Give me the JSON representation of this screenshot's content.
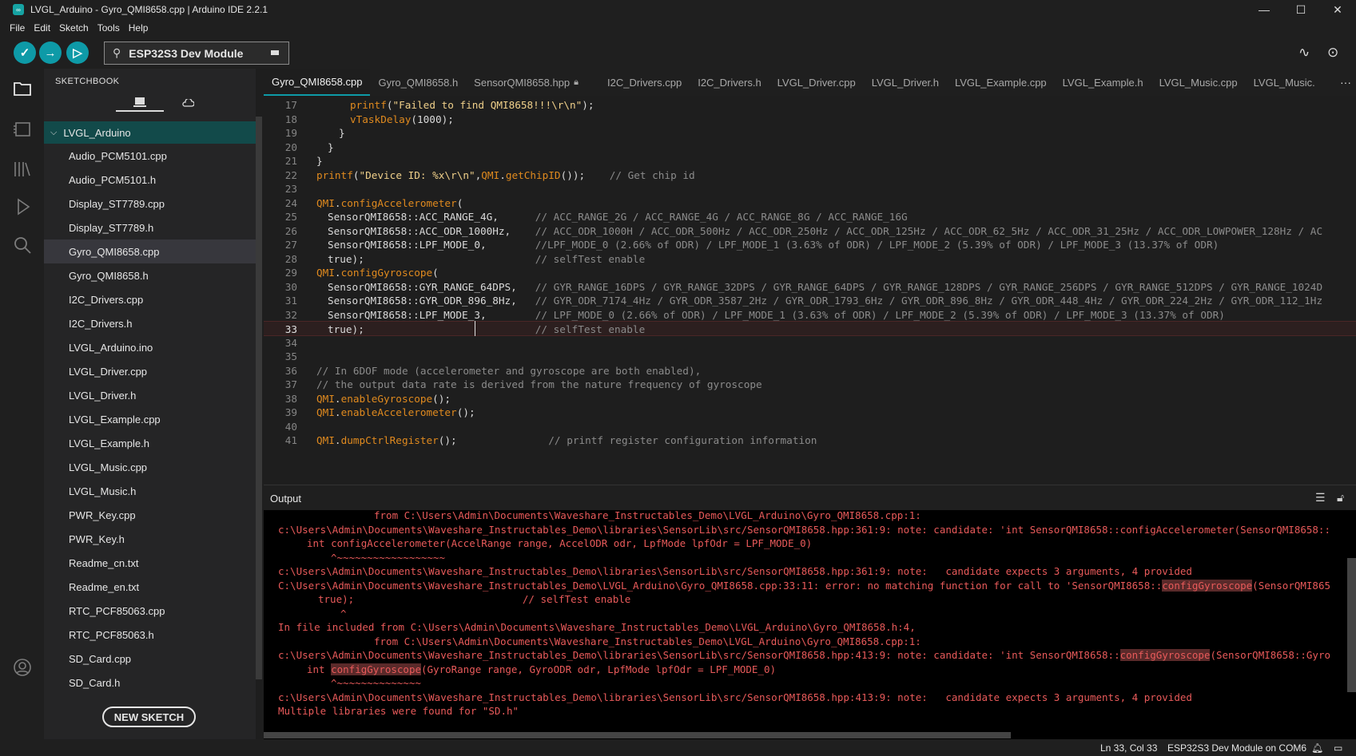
{
  "window": {
    "title": "LVGL_Arduino - Gyro_QMI8658.cpp | Arduino IDE 2.2.1",
    "app_icon": "arduino-logo",
    "minimize": "—",
    "maximize": "☐",
    "close": "✕"
  },
  "menu": [
    "File",
    "Edit",
    "Sketch",
    "Tools",
    "Help"
  ],
  "toolbar": {
    "board": "ESP32S3 Dev Module",
    "verify_icon": "✓",
    "upload_icon": "→",
    "debug_icon": "▷",
    "serial_plotter_icon": "∿",
    "serial_monitor_icon": "⊙",
    "accent": "#0e9aa7"
  },
  "sidebar": {
    "title": "SKETCHBOOK",
    "local_tab_icon": "laptop-icon",
    "cloud_tab_icon": "cloud-icon",
    "folder": "LVGL_Arduino",
    "files": [
      "Audio_PCM5101.cpp",
      "Audio_PCM5101.h",
      "Display_ST7789.cpp",
      "Display_ST7789.h",
      "Gyro_QMI8658.cpp",
      "Gyro_QMI8658.h",
      "I2C_Drivers.cpp",
      "I2C_Drivers.h",
      "LVGL_Arduino.ino",
      "LVGL_Driver.cpp",
      "LVGL_Driver.h",
      "LVGL_Example.cpp",
      "LVGL_Example.h",
      "LVGL_Music.cpp",
      "LVGL_Music.h",
      "PWR_Key.cpp",
      "PWR_Key.h",
      "Readme_cn.txt",
      "Readme_en.txt",
      "RTC_PCF85063.cpp",
      "RTC_PCF85063.h",
      "SD_Card.cpp",
      "SD_Card.h"
    ],
    "selected_file": "Gyro_QMI8658.cpp",
    "new_sketch": "NEW SKETCH"
  },
  "tabs": [
    "Gyro_QMI8658.cpp",
    "Gyro_QMI8658.h",
    "SensorQMI8658.hpp",
    "I2C_Drivers.cpp",
    "I2C_Drivers.h",
    "LVGL_Driver.cpp",
    "LVGL_Driver.h",
    "LVGL_Example.cpp",
    "LVGL_Example.h",
    "LVGL_Music.cpp",
    "LVGL_Music."
  ],
  "code": {
    "current_line": 33,
    "lines": [
      {
        "n": "17",
        "text": "printf(\"Failed to find QMI8658!!!\\r\\n\");"
      },
      {
        "n": "18",
        "text": "vTaskDelay(1000);"
      },
      {
        "n": "19",
        "text": "}"
      },
      {
        "n": "20",
        "text": "}"
      },
      {
        "n": "21",
        "text": "}"
      },
      {
        "n": "22",
        "text": "printf(\"Device ID: %x\\r\\n\",QMI.getChipID());    // Get chip id"
      },
      {
        "n": "23",
        "text": ""
      },
      {
        "n": "24",
        "text": "QMI.configAccelerometer("
      },
      {
        "n": "25",
        "text": "SensorQMI8658::ACC_RANGE_4G,      // ACC_RANGE_2G / ACC_RANGE_4G / ACC_RANGE_8G / ACC_RANGE_16G"
      },
      {
        "n": "26",
        "text": "SensorQMI8658::ACC_ODR_1000Hz,    // ACC_ODR_1000H / ACC_ODR_500Hz / ACC_ODR_250Hz / ACC_ODR_125Hz / ACC_ODR_62_5Hz / ACC_ODR_31_25Hz / ACC_ODR_LOWPOWER_128Hz / AC"
      },
      {
        "n": "27",
        "text": "SensorQMI8658::LPF_MODE_0,        //LPF_MODE_0 (2.66% of ODR) / LPF_MODE_1 (3.63% of ODR) / LPF_MODE_2 (5.39% of ODR) / LPF_MODE_3 (13.37% of ODR)"
      },
      {
        "n": "28",
        "text": "true);                            // selfTest enable"
      },
      {
        "n": "29",
        "text": "QMI.configGyroscope("
      },
      {
        "n": "30",
        "text": "SensorQMI8658::GYR_RANGE_64DPS,   // GYR_RANGE_16DPS / GYR_RANGE_32DPS / GYR_RANGE_64DPS / GYR_RANGE_128DPS / GYR_RANGE_256DPS / GYR_RANGE_512DPS / GYR_RANGE_1024D"
      },
      {
        "n": "31",
        "text": "SensorQMI8658::GYR_ODR_896_8Hz,   // GYR_ODR_7174_4Hz / GYR_ODR_3587_2Hz / GYR_ODR_1793_6Hz / GYR_ODR_896_8Hz / GYR_ODR_448_4Hz / GYR_ODR_224_2Hz / GYR_ODR_112_1Hz"
      },
      {
        "n": "32",
        "text": "SensorQMI8658::LPF_MODE_3,        // LPF_MODE_0 (2.66% of ODR) / LPF_MODE_1 (3.63% of ODR) / LPF_MODE_2 (5.39% of ODR) / LPF_MODE_3 (13.37% of ODR)"
      },
      {
        "n": "33",
        "text": "true);                            // selfTest enable"
      },
      {
        "n": "34",
        "text": ""
      },
      {
        "n": "35",
        "text": ""
      },
      {
        "n": "36",
        "text": "// In 6DOF mode (accelerometer and gyroscope are both enabled),"
      },
      {
        "n": "37",
        "text": "// the output data rate is derived from the nature frequency of gyroscope"
      },
      {
        "n": "38",
        "text": "QMI.enableGyroscope();"
      },
      {
        "n": "39",
        "text": "QMI.enableAccelerometer();"
      },
      {
        "n": "40",
        "text": ""
      },
      {
        "n": "41",
        "text": "QMI.dumpCtrlRegister();               // printf register configuration information"
      }
    ]
  },
  "output": {
    "title": "Output",
    "clear_icon": "clear-lines-icon",
    "lock_icon": "lock-icon",
    "lines": [
      "from C:\\Users\\Admin\\Documents\\Waveshare_Instructables_Demo\\LVGL_Arduino\\Gyro_QMI8658.cpp:1:",
      "c:\\Users\\Admin\\Documents\\Waveshare_Instructables_Demo\\libraries\\SensorLib\\src/SensorQMI8658.hpp:361:9: note: candidate: 'int SensorQMI8658::configAccelerometer(SensorQMI8658::",
      "int configAccelerometer(AccelRange range, AccelODR odr, LpfMode lpfOdr = LPF_MODE_0)",
      "^~~~~~~~~~~~~~~~~~~",
      "c:\\Users\\Admin\\Documents\\Waveshare_Instructables_Demo\\libraries\\SensorLib\\src/SensorQMI8658.hpp:361:9: note:   candidate expects 3 arguments, 4 provided",
      "C:\\Users\\Admin\\Documents\\Waveshare_Instructables_Demo\\LVGL_Arduino\\Gyro_QMI8658.cpp:33:11: error: no matching function for call to 'SensorQMI8658::configGyroscope(SensorQMI865",
      "true);                            // selfTest enable",
      "^",
      "In file included from C:\\Users\\Admin\\Documents\\Waveshare_Instructables_Demo\\LVGL_Arduino\\Gyro_QMI8658.h:4,",
      "from C:\\Users\\Admin\\Documents\\Waveshare_Instructables_Demo\\LVGL_Arduino\\Gyro_QMI8658.cpp:1:",
      "c:\\Users\\Admin\\Documents\\Waveshare_Instructables_Demo\\libraries\\SensorLib\\src/SensorQMI8658.hpp:413:9: note: candidate: 'int SensorQMI8658::configGyroscope(SensorQMI8658::Gyro",
      "int configGyroscope(GyroRange range, GyroODR odr, LpfMode lpfOdr = LPF_MODE_0)",
      "^~~~~~~~~~~~~~~",
      "c:\\Users\\Admin\\Documents\\Waveshare_Instructables_Demo\\libraries\\SensorLib\\src/SensorQMI8658.hpp:413:9: note:   candidate expects 3 arguments, 4 provided",
      "Multiple libraries were found for \"SD.h\""
    ],
    "error_color": "#e85a5a"
  },
  "status": {
    "position": "Ln 33, Col 33",
    "board_port": "ESP32S3 Dev Module on COM6",
    "bell_icon": "bell-icon",
    "layout_icon": "panel-icon"
  }
}
